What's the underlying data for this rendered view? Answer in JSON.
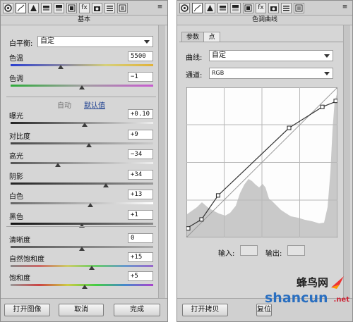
{
  "left_panel": {
    "section_title": "基本",
    "white_balance": {
      "label": "白平衡:",
      "value": "自定"
    },
    "sliders_top": [
      {
        "label": "色温",
        "value": "5500",
        "position": 0.35
      },
      {
        "label": "色调",
        "value": "−1",
        "position": 0.5
      }
    ],
    "auto_label": "自动",
    "default_label": "默认值",
    "sliders_mid": [
      {
        "label": "曝光",
        "value": "+0.10",
        "position": 0.52
      },
      {
        "label": "对比度",
        "value": "+9",
        "position": 0.55
      },
      {
        "label": "高光",
        "value": "−34",
        "position": 0.33
      },
      {
        "label": "阴影",
        "value": "+34",
        "position": 0.67
      },
      {
        "label": "白色",
        "value": "+13",
        "position": 0.56
      },
      {
        "label": "黑色",
        "value": "+1",
        "position": 0.5
      }
    ],
    "sliders_bottom": [
      {
        "label": "清晰度",
        "value": "0",
        "position": 0.5
      },
      {
        "label": "自然饱和度",
        "value": "+15",
        "position": 0.57
      },
      {
        "label": "饱和度",
        "value": "+5",
        "position": 0.52
      }
    ],
    "buttons": {
      "open": "打开图像",
      "cancel": "取消",
      "done": "完成"
    }
  },
  "right_panel": {
    "section_title": "色调曲线",
    "tabs": [
      "参数",
      "点"
    ],
    "curve": {
      "label": "曲线:",
      "value": "自定"
    },
    "channel": {
      "label": "通道:",
      "value": "RGB"
    },
    "input_label": "输入:",
    "output_label": "输出:",
    "buttons": {
      "open_copy": "打开拷贝",
      "reset": "复位"
    },
    "curve_points": [
      [
        0,
        0.06
      ],
      [
        0.1,
        0.12
      ],
      [
        0.21,
        0.28
      ],
      [
        0.68,
        0.73
      ],
      [
        0.9,
        0.87
      ],
      [
        1,
        0.91
      ]
    ]
  },
  "watermark": {
    "line1": "蜂鸟网",
    "line2": "shancun",
    "suffix": ".net"
  }
}
